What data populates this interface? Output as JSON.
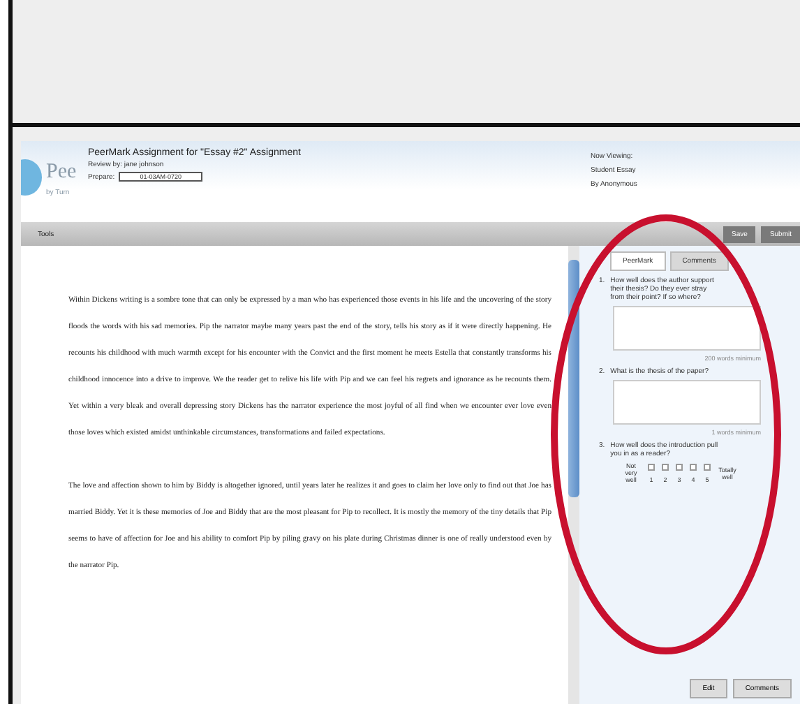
{
  "header": {
    "logo_text": "Pee",
    "logo_sub": "by Turn",
    "title": "PeerMark Assignment for \"Essay #2\" Assignment",
    "reviewer": "Review by: jane johnson",
    "prepare_label": "Prepare:",
    "prepare_value": "01-03AM-0720",
    "viewing": [
      "Now Viewing:",
      "Student Essay",
      "By Anonymous"
    ]
  },
  "toolbar": {
    "tools": "Tools",
    "buttons": [
      "Save",
      "Submit"
    ]
  },
  "essay": {
    "paragraphs": [
      "Within Dickens writing is a sombre tone that can only be expressed by a man who has experienced those events in his life and the uncovering of the story floods the words with his sad memories. Pip the narrator maybe many years past the end of the story, tells his story as if it were directly happening. He recounts his childhood with much warmth except for his encounter with the Convict and the first moment he meets Estella that constantly transforms his childhood innocence into a drive to improve. We the reader get to relive his life with Pip and we can feel his regrets and ignorance as he recounts them. Yet within a very bleak and overall depressing story Dickens has the narrator experience the most joyful of all find when we encounter ever love even those loves which existed amidst unthinkable circumstances, transformations and failed expectations.",
      "The love and affection shown to him by Biddy is altogether ignored, until years later he realizes it and goes to claim her love only to find out that Joe has married Biddy. Yet it is these memories of Joe and Biddy that are the most pleasant for Pip to recollect. It is mostly the memory of the tiny details that Pip seems to have of affection for Joe and his ability to comfort Pip by piling gravy on his plate during Christmas dinner is one of really understood even by the narrator Pip."
    ]
  },
  "panel": {
    "tabs": [
      {
        "label": "PeerMark",
        "selected": true
      },
      {
        "label": "Comments",
        "selected": false
      }
    ],
    "questions": [
      {
        "kind": "text",
        "number": "1.",
        "prompt": "How well does the author support their thesis? Do they ever stray from their point? If so where?",
        "hint": "200 words minimum"
      },
      {
        "kind": "text",
        "number": "2.",
        "prompt": "What is the thesis of the paper?",
        "hint": "1 words minimum"
      },
      {
        "kind": "scale",
        "number": "3.",
        "prompt": "How well does the introduction pull you in as a reader?",
        "low": "Not very well",
        "high": "Totally well",
        "options": [
          {
            "label": "1",
            "selected": false
          },
          {
            "label": "2",
            "selected": false
          },
          {
            "label": "3",
            "selected": false
          },
          {
            "label": "4",
            "selected": false
          },
          {
            "label": "5",
            "selected": false
          }
        ]
      }
    ],
    "buttons": [
      "Edit",
      "Comments"
    ]
  }
}
